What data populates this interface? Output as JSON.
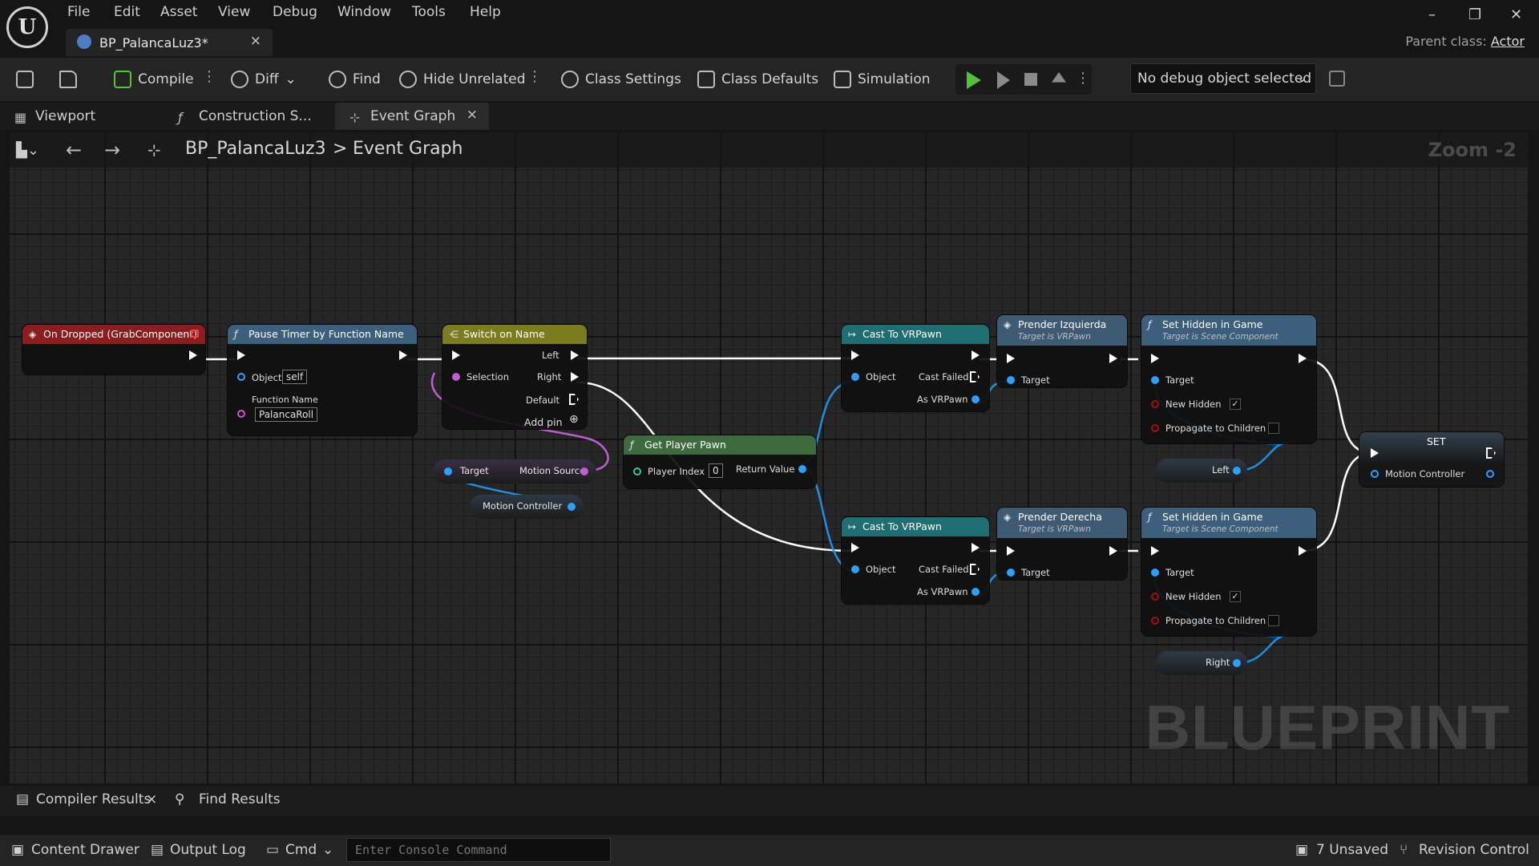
{
  "menu": {
    "items": [
      "File",
      "Edit",
      "Asset",
      "View",
      "Debug",
      "Window",
      "Tools",
      "Help"
    ],
    "logo": "U"
  },
  "document_tab": {
    "title": "BP_PalancaLuz3*",
    "close": "×"
  },
  "window": {
    "minimize": "–",
    "restore": "❐",
    "close": "✕"
  },
  "parent_class": {
    "label": "Parent class:",
    "value": "Actor"
  },
  "toolbar": {
    "compile": "Compile",
    "diff": "Diff",
    "find": "Find",
    "hide_unrelated": "Hide Unrelated",
    "class_settings": "Class Settings",
    "class_defaults": "Class Defaults",
    "simulation": "Simulation",
    "debug_object": "No debug object selected"
  },
  "editor_tabs": [
    "Viewport",
    "Construction S...",
    "Event Graph"
  ],
  "breadcrumb": {
    "blueprint": "BP_PalancaLuz3",
    "separator": ">",
    "graph": "Event Graph",
    "zoom": "Zoom -2"
  },
  "watermark": "BLUEPRINT",
  "nodes": {
    "on_dropped": {
      "title": "On Dropped (GrabComponent)",
      "color": "#8a1d1d"
    },
    "pause_timer": {
      "title": "Pause Timer by Function Name",
      "object_label": "Object",
      "object_value": "self",
      "function_label": "Function Name",
      "function_value": "PalancaRoll",
      "color": "#3b5f7d"
    },
    "switch_name": {
      "title": "Switch on Name",
      "selection": "Selection",
      "left": "Left",
      "right": "Right",
      "default": "Default",
      "add_pin": "Add pin",
      "color": "#7a7c1e"
    },
    "get_player_pawn": {
      "title": "Get Player Pawn",
      "player_index": "Player Index",
      "index_value": "0",
      "return_value": "Return Value",
      "color": "#3d6b3e"
    },
    "motion_source": {
      "target": "Target",
      "output": "Motion Source"
    },
    "motion_controller_var": {
      "label": "Motion Controller"
    },
    "cast_top": {
      "title": "Cast To VRPawn",
      "object": "Object",
      "cast_failed": "Cast Failed",
      "as_vrpawn": "As VRPawn",
      "color": "#1f6e72"
    },
    "cast_bottom": {
      "title": "Cast To VRPawn",
      "object": "Object",
      "cast_failed": "Cast Failed",
      "as_vrpawn": "As VRPawn",
      "color": "#1f6e72"
    },
    "prender_izq": {
      "title": "Prender Izquierda",
      "subtitle": "Target is VRPawn",
      "target": "Target",
      "color": "#3f5a73"
    },
    "prender_der": {
      "title": "Prender Derecha",
      "subtitle": "Target is VRPawn",
      "target": "Target",
      "color": "#3f5a73"
    },
    "hidden_top": {
      "title": "Set Hidden in Game",
      "subtitle": "Target is Scene Component",
      "target": "Target",
      "new_hidden": "New Hidden",
      "propagate": "Propagate to Children",
      "check": "✓",
      "color": "#3b5f7d"
    },
    "hidden_bottom": {
      "title": "Set Hidden in Game",
      "subtitle": "Target is Scene Component",
      "target": "Target",
      "new_hidden": "New Hidden",
      "propagate": "Propagate to Children",
      "check": "✓",
      "color": "#3b5f7d"
    },
    "left_var": {
      "label": "Left"
    },
    "right_var": {
      "label": "Right"
    },
    "set_node": {
      "title": "SET",
      "pin": "Motion Controller"
    }
  },
  "bottom_tabs": {
    "compiler_results": "Compiler Results",
    "close": "×",
    "find_results": "Find Results"
  },
  "status": {
    "content_drawer": "Content Drawer",
    "output_log": "Output Log",
    "cmd": "Cmd",
    "console_placeholder": "Enter Console Command",
    "unsaved": "7 Unsaved",
    "revision": "Revision Control"
  }
}
